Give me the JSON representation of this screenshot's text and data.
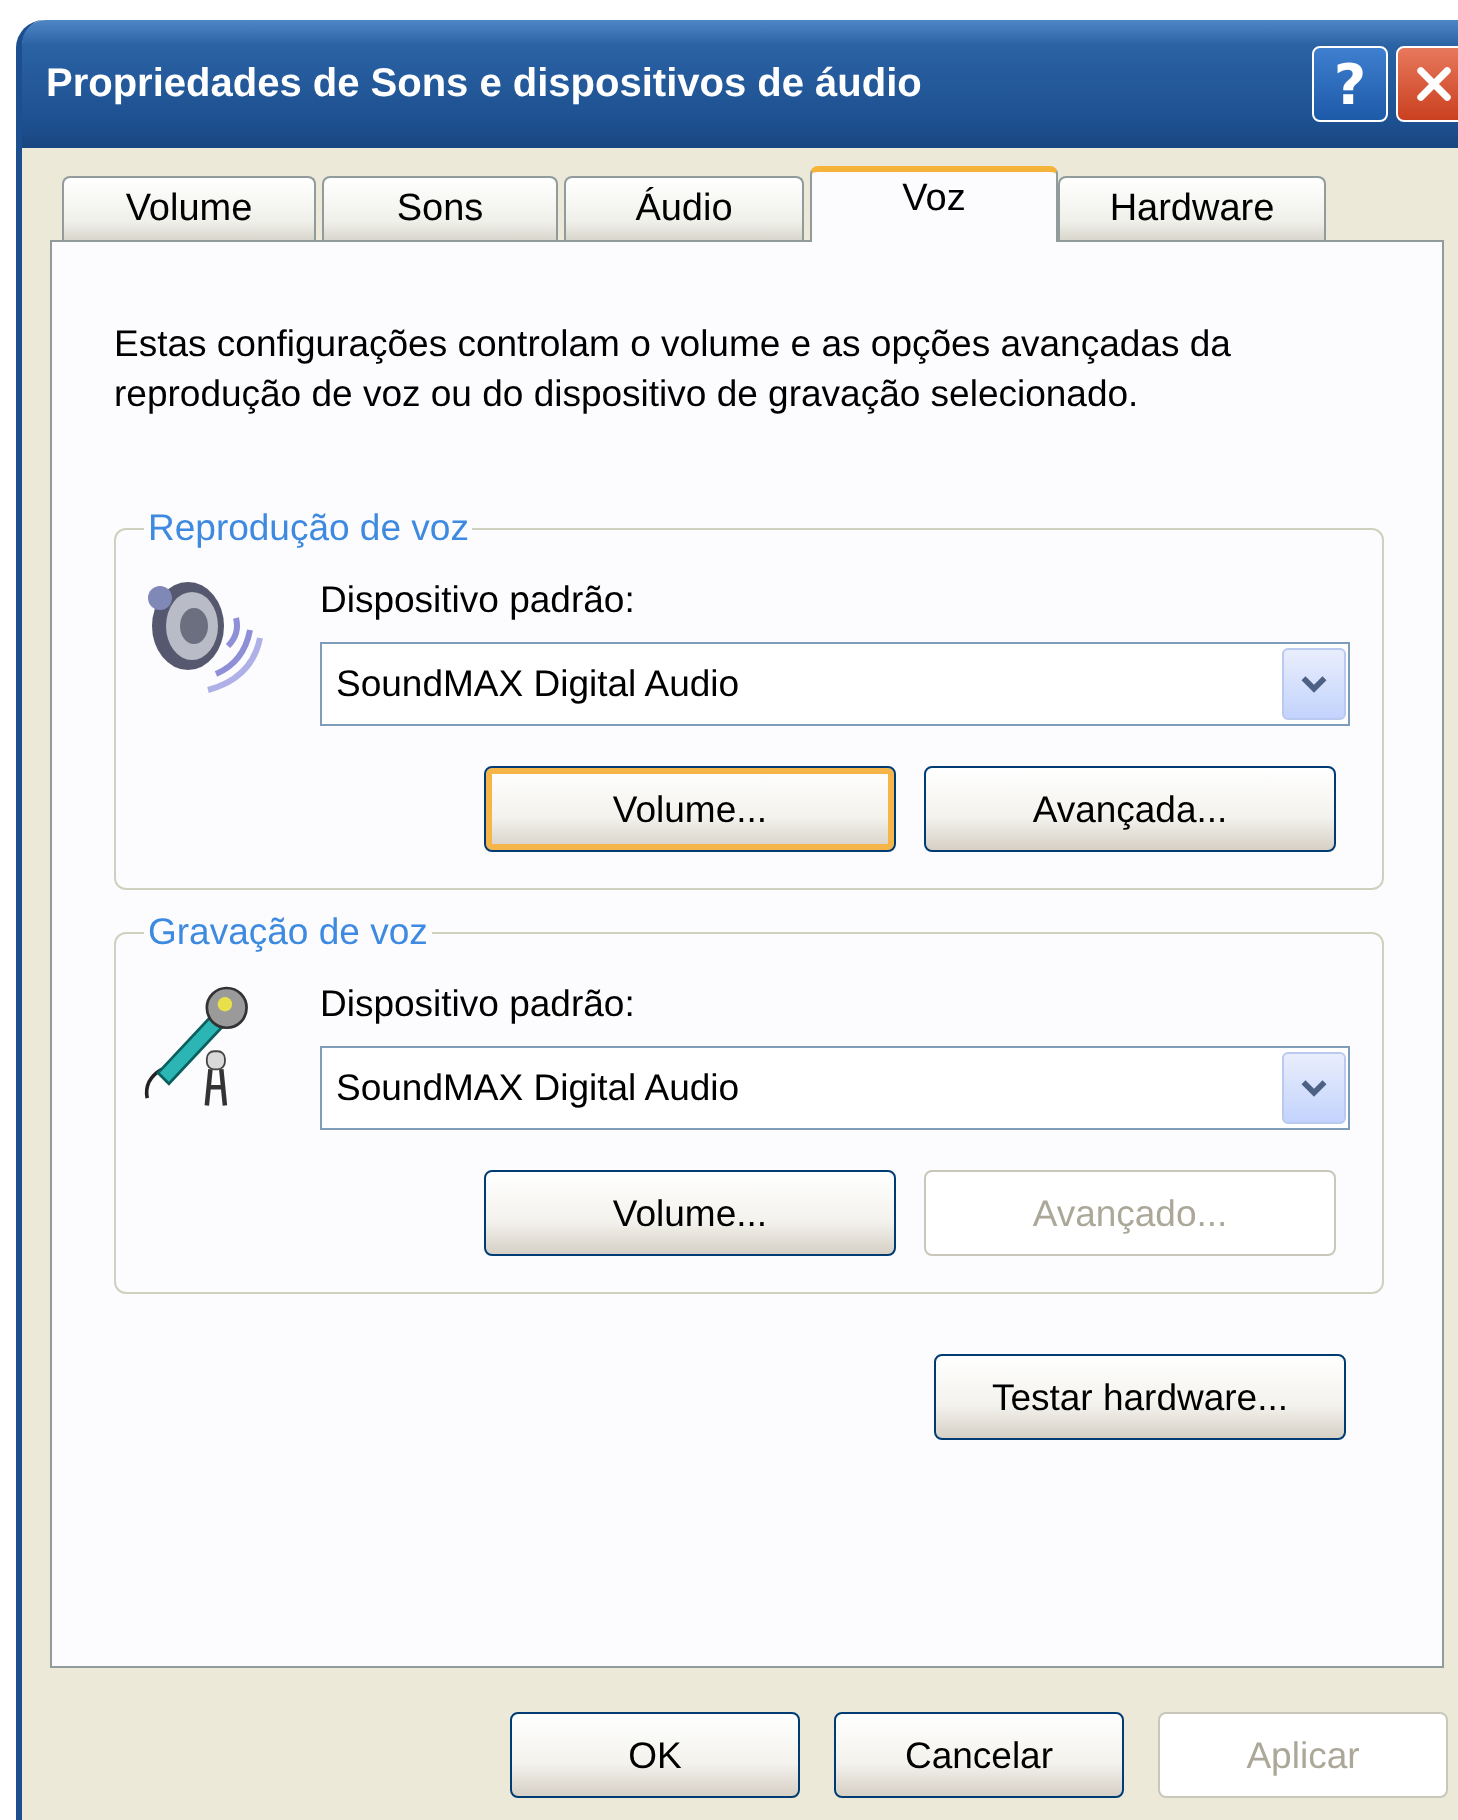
{
  "window": {
    "title": "Propriedades de Sons e dispositivos de áudio",
    "help": "?"
  },
  "tabs": [
    {
      "label": "Volume",
      "selected": false
    },
    {
      "label": "Sons",
      "selected": false
    },
    {
      "label": "Áudio",
      "selected": false
    },
    {
      "label": "Voz",
      "selected": true
    },
    {
      "label": "Hardware",
      "selected": false
    }
  ],
  "description": "Estas configurações controlam o volume e as opções avançadas da reprodução de voz ou do dispositivo de gravação selecionado.",
  "groups": [
    {
      "title": "Reprodução de voz",
      "kind": "speaker",
      "device_label": "Dispositivo padrão:",
      "device_value": "SoundMAX Digital Audio",
      "buttons": [
        {
          "label": "Volume...",
          "disabled": false,
          "focused": true
        },
        {
          "label": "Avançada...",
          "disabled": false,
          "focused": false
        }
      ]
    },
    {
      "title": "Gravação de voz",
      "kind": "microphone",
      "device_label": "Dispositivo padrão:",
      "device_value": "SoundMAX Digital Audio",
      "buttons": [
        {
          "label": "Volume...",
          "disabled": false,
          "focused": false
        },
        {
          "label": "Avançado...",
          "disabled": true,
          "focused": false
        }
      ]
    }
  ],
  "test_button": {
    "label": "Testar hardware...",
    "disabled": false
  },
  "buttons": [
    {
      "label": "OK",
      "disabled": false
    },
    {
      "label": "Cancelar",
      "disabled": false
    },
    {
      "label": "Aplicar",
      "disabled": true
    }
  ]
}
